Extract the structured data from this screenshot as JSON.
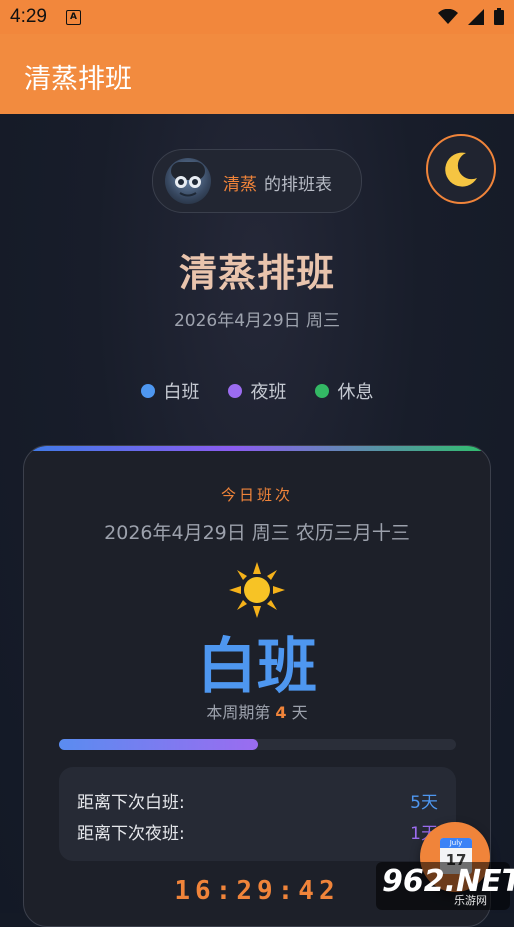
{
  "status_bar": {
    "time": "4:29",
    "icons": [
      "a-icon",
      "wifi-icon",
      "signal-icon",
      "battery-icon"
    ]
  },
  "app_bar": {
    "title": "清蒸排班"
  },
  "profile": {
    "name": "清蒸",
    "suffix": "的排班表"
  },
  "theme_toggle": {
    "icon": "moon-icon"
  },
  "header": {
    "title": "清蒸排班",
    "date": "2026年4月29日  周三"
  },
  "legend": [
    {
      "label": "白班",
      "color": "#4e97f0"
    },
    {
      "label": "夜班",
      "color": "#9b6cf0"
    },
    {
      "label": "休息",
      "color": "#33b864"
    }
  ],
  "today": {
    "label": "今日班次",
    "full_date": "2026年4月29日  周三  农历三月十三",
    "icon": "sun-icon",
    "shift": "白班",
    "shift_color": "#4e97f0",
    "cycle_prefix": "本周期第",
    "cycle_day": "4",
    "cycle_suffix": "天",
    "progress": 0.5
  },
  "countdown": [
    {
      "label": "距离下次白班:",
      "value": "5天",
      "color": "#4e97f0"
    },
    {
      "label": "距离下次夜班:",
      "value": "1天",
      "color": "#9b6cf0"
    }
  ],
  "clock": "16:29:42",
  "fab": {
    "icon": "calendar-icon",
    "month": "July",
    "day": "17"
  },
  "watermark": {
    "brand": "962.NET",
    "sub": "乐游网"
  }
}
